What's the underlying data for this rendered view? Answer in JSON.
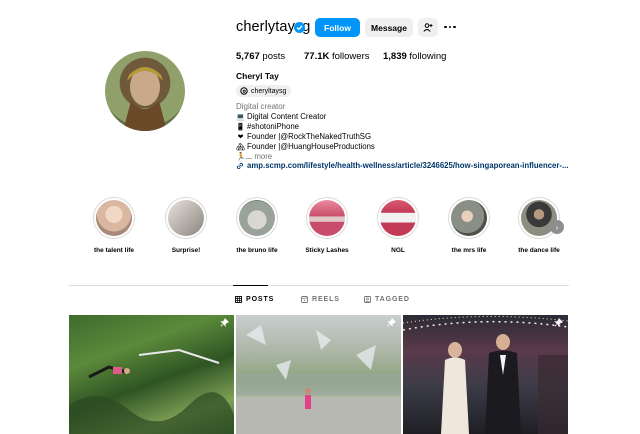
{
  "profile": {
    "username": "cherlytaysg",
    "full_name": "Cheryl Tay",
    "threads_handle": "cheryltaysg",
    "category": "Digital creator",
    "bio_lines": [
      {
        "icon": "laptop-emoji",
        "glyph": "💻",
        "text": "Digital Content Creator"
      },
      {
        "icon": "phone-emoji",
        "glyph": "📱",
        "text": "#shotoniPhone"
      },
      {
        "icon": "heart-emoji",
        "glyph": "❤",
        "text": "Founder |@RockTheNakedTruthSG"
      },
      {
        "icon": "house-emoji",
        "glyph": "🏘",
        "text": "Founder |@HuangHouseProductions"
      }
    ],
    "bio_truncated": "🏃‍... ",
    "more_label": "more",
    "url": "amp.scmp.com/lifestyle/health-wellness/article/3246625/how-singaporean-influencer-..."
  },
  "actions": {
    "follow_label": "Follow",
    "message_label": "Message"
  },
  "stats": {
    "posts_count": "5,767",
    "posts_label": "posts",
    "followers_count": "77.1K",
    "followers_label": "followers",
    "following_count": "1,839",
    "following_label": "following"
  },
  "highlights": [
    {
      "label": "the talent life",
      "color": "#d9b7a0"
    },
    {
      "label": "Surprise!",
      "color": "#b9b3ad"
    },
    {
      "label": "the bruno life",
      "color": "#9aa39a"
    },
    {
      "label": "Sticky Lashes",
      "color": "#c94d6a"
    },
    {
      "label": "NGL",
      "color": "#c23a55"
    },
    {
      "label": "the mrs life",
      "color": "#8a8f86"
    },
    {
      "label": "the dance life",
      "color": "#8c8f80"
    }
  ],
  "tabs": [
    {
      "label": "POSTS",
      "active": true
    },
    {
      "label": "REELS",
      "active": false
    },
    {
      "label": "TAGGED",
      "active": false
    }
  ],
  "colors": {
    "accent": "#0095f6",
    "link": "#00376b",
    "muted": "#737373"
  }
}
